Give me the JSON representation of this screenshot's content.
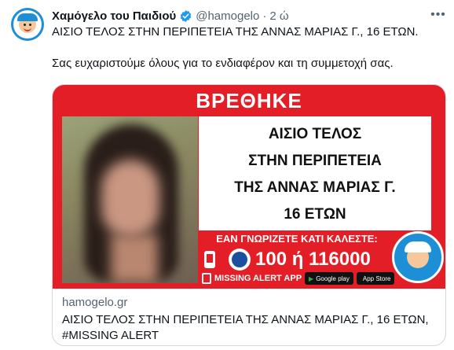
{
  "author": {
    "name": "Χαμόγελο του Παιδιού",
    "handle": "@hamogelo",
    "separator": "·",
    "time": "2 ώ"
  },
  "tweet": {
    "line1": "ΑΙΣΙΟ ΤΕΛΟΣ ΣΤΗΝ ΠΕΡΙΠΕΤΕΙΑ ΤΗΣ ΑΝΝΑΣ ΜΑΡΙΑΣ Γ., 16 ΕΤΩΝ.",
    "line2": "Σας ευχαριστούμε όλους για το ενδιαφέρον και τη συμμετοχή σας."
  },
  "poster": {
    "found": "ΒΡΕΘΗΚΕ",
    "lines": [
      "ΑΙΣΙΟ ΤΕΛΟΣ",
      "ΣΤΗΝ ΠΕΡΙΠΕΤΕΙΑ",
      "ΤΗΣ ΑΝΝΑΣ ΜΑΡΙΑΣ Γ.",
      "16 ΕΤΩΝ"
    ],
    "call": "ΕΑΝ ΓΝΩΡΙΖΕΤΕ ΚΑΤΙ ΚΑΛΕΣΤΕ:",
    "phones": "100 ή 116000",
    "app": "MISSING ALERT APP",
    "google_play": "Google play",
    "app_store": "App Store"
  },
  "card": {
    "domain": "hamogelo.gr",
    "title_line1": "ΑΙΣΙΟ ΤΕΛΟΣ ΣΤΗΝ ΠΕΡΙΠΕΤΕΙΑ ΤΗΣ ΑΝΝΑΣ ΜΑΡΙΑΣ Γ., 16 ΕΤΩΝ,",
    "title_line2": "#MISSING ALERT"
  },
  "colors": {
    "poster_red": "#e41e26",
    "verified_blue": "#1d9bf0",
    "brand_blue": "#1d8fd6"
  },
  "icons": {
    "verified": "verified-badge-icon",
    "more": "more-options-icon",
    "phone": "phone-icon",
    "police": "police-emblem-icon"
  }
}
